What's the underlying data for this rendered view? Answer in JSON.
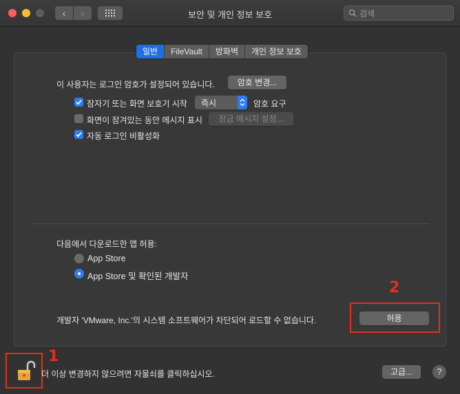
{
  "window": {
    "title": "보안 및 개인 정보 보호"
  },
  "toolbar": {
    "search_placeholder": "검색"
  },
  "tabs": [
    {
      "label": "일반",
      "active": true
    },
    {
      "label": "FileVault",
      "active": false
    },
    {
      "label": "방화벽",
      "active": false
    },
    {
      "label": "개인 정보 보호",
      "active": false
    }
  ],
  "general": {
    "password_text": "이 사용자는 로그인 암호가 설정되어 있습니다.",
    "change_password_button": "암호 변경...",
    "require_password": {
      "label": "잠자기 또는 화면 보호기 시작",
      "checked": true,
      "select_value": "즉시",
      "suffix": "암호 요구"
    },
    "show_message": {
      "label": "화면이 잠겨있는 동안 메시지 표시",
      "checked": false,
      "button": "잠금 메시지 설정..."
    },
    "disable_auto_login": {
      "label": "자동 로그인 비활성화",
      "checked": true
    }
  },
  "downloads": {
    "heading": "다음에서 다운로드한 앱 허용:",
    "options": [
      {
        "label": "App Store",
        "selected": false
      },
      {
        "label": "App Store 및 확인된 개발자",
        "selected": true
      }
    ],
    "blocked_text": "개발자 'VMware, Inc.'의 시스템 소프트웨어가 차단되어 로드할 수 없습니다.",
    "allow_button": "허용"
  },
  "footer": {
    "lock_text": "더 이상 변경하지 않으려면 자물쇠를 클릭하십시오.",
    "advanced_button": "고급...",
    "help": "?"
  },
  "annotations": [
    {
      "number": "1"
    },
    {
      "number": "2"
    }
  ],
  "colors": {
    "accent": "#2e7cf6",
    "annotation": "#e62e1c",
    "lock": "#e8a33a"
  }
}
